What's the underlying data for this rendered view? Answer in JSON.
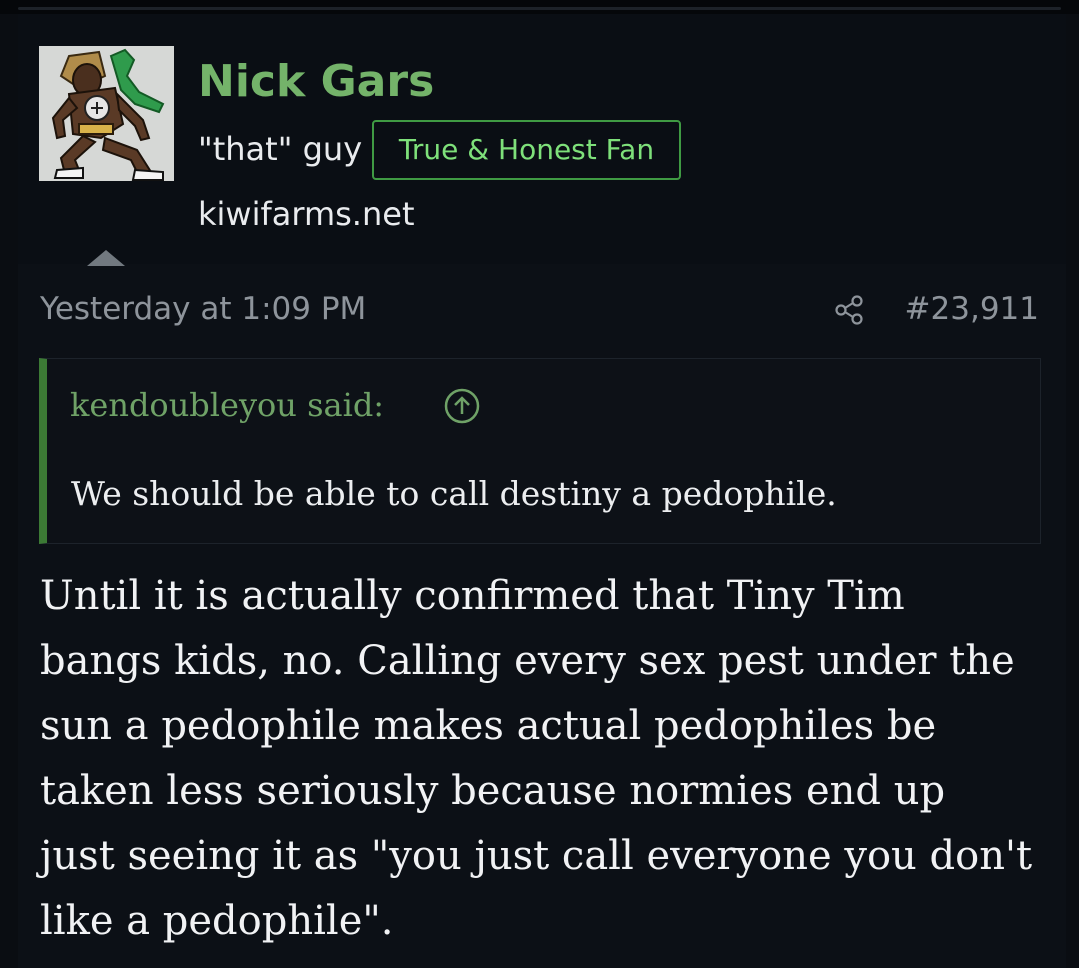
{
  "user": {
    "name": "Nick Gars",
    "title": "\"that\" guy",
    "banner": "True & Honest Fan",
    "site": "kiwifarms.net"
  },
  "post": {
    "date": "Yesterday at 1:09 PM",
    "number": "#23,911",
    "share_icon": "share-icon",
    "quote": {
      "attribution": "kendoubleyou said:",
      "jump_icon": "arrow-up-circle-icon",
      "text": "We should be able to call destiny a pedophile."
    },
    "body_lines": [
      "Until it is actually confirmed that Tiny Tim",
      "bangs kids, no. Calling every sex pest under the",
      "sun a pedophile makes actual pedophiles be",
      "taken less seriously because normies end up",
      "just seeing it as \"you just call everyone you don't",
      "like a pedophile\"."
    ]
  },
  "colors": {
    "username": "#74b36a",
    "banner": "#7ee07a",
    "banner_border": "#3f9a43",
    "quote_accent": "#3c7a35",
    "quote_attrib": "#6fa267",
    "background": "#0a0d12"
  }
}
